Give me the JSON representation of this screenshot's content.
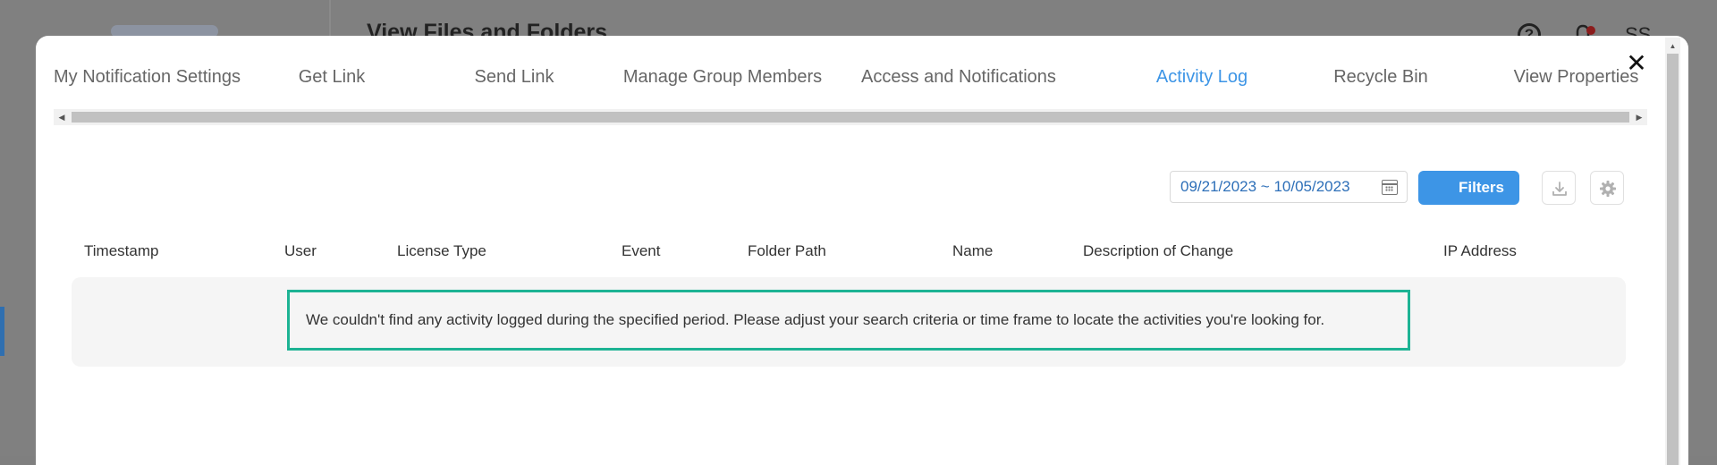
{
  "background": {
    "page_title": "View Files and Folders",
    "help_label": "?",
    "user_initials": "SS"
  },
  "modal": {
    "close_label": "✕",
    "tabs": [
      {
        "label": "My Notification Settings",
        "active": false
      },
      {
        "label": "Get Link",
        "active": false
      },
      {
        "label": "Send Link",
        "active": false
      },
      {
        "label": "Manage Group Members",
        "active": false
      },
      {
        "label": "Access and Notifications",
        "active": false
      },
      {
        "label": "Activity Log",
        "active": true
      },
      {
        "label": "Recycle Bin",
        "active": false
      },
      {
        "label": "View Properties",
        "active": false
      }
    ],
    "toolbar": {
      "date_range": "09/21/2023 ~ 10/05/2023",
      "filters_label": "Filters",
      "download_icon": "download-icon",
      "settings_icon": "gear-icon"
    },
    "table": {
      "columns": [
        "Timestamp",
        "User",
        "License Type",
        "Event",
        "Folder Path",
        "Name",
        "Description of Change",
        "IP Address"
      ],
      "empty_message": "We couldn't find any activity logged during the specified period. Please adjust your search criteria or time frame to locate the activities you're looking for."
    }
  },
  "colors": {
    "accent": "#3d95e6",
    "highlight_border": "#1db394",
    "overlay": "#808080"
  }
}
